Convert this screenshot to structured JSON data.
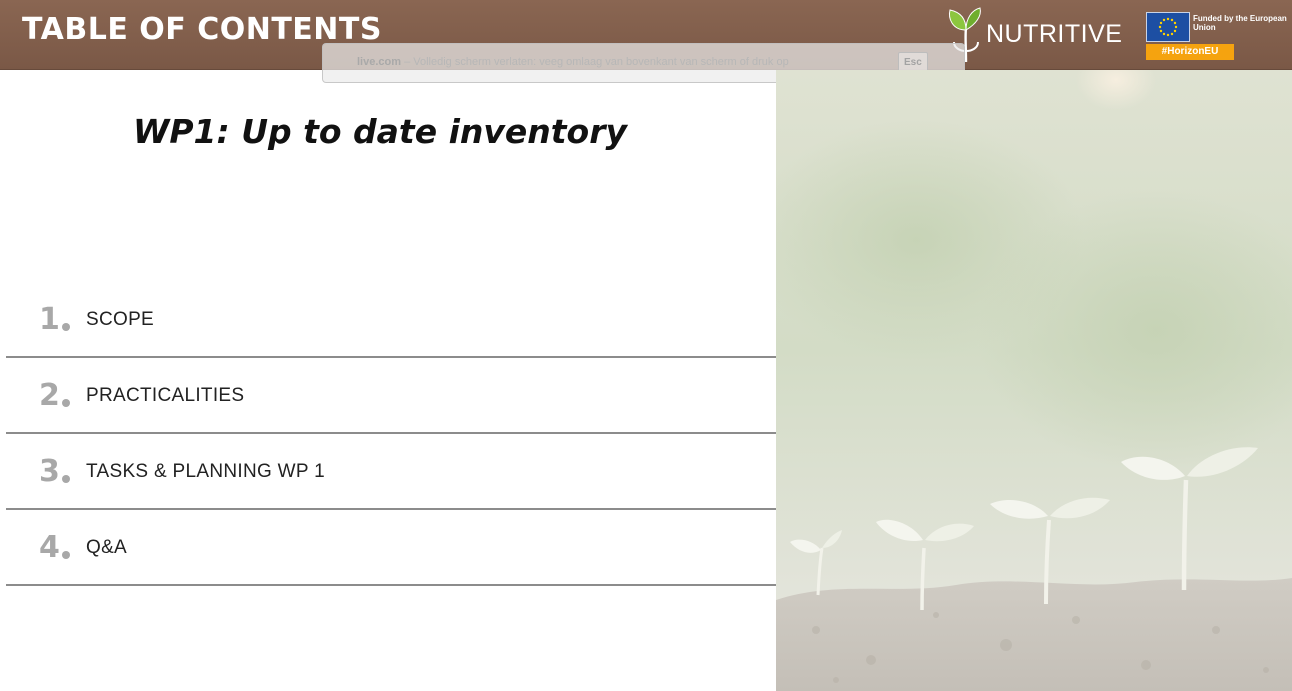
{
  "header": {
    "title": "TABLE OF CONTENTS",
    "brand_name": "NUTRITIVE",
    "eu_funded": "Funded by the European Union",
    "eu_tag": "#HorizonEU"
  },
  "fullscreen_notice": {
    "site": "live.com",
    "separator": " – ",
    "message": "Volledig scherm verlaten: veeg omlaag van bovenkant van scherm of druk op",
    "key": "Esc"
  },
  "slide": {
    "heading": "WP1: Up to date inventory",
    "items": [
      {
        "number": "1",
        "label": "SCOPE"
      },
      {
        "number": "2",
        "label": "PRACTICALITIES"
      },
      {
        "number": "3",
        "label": "TASKS & PLANNING WP 1"
      },
      {
        "number": "4",
        "label": "Q&A"
      }
    ]
  },
  "colors": {
    "header_bg": "#7f5c49",
    "eu_tag": "#f5a30f",
    "eu_flag": "#1d4fa3",
    "number_gray": "#a8a8a8"
  },
  "icons": [
    "sprout-icon",
    "eu-flag-icon"
  ]
}
